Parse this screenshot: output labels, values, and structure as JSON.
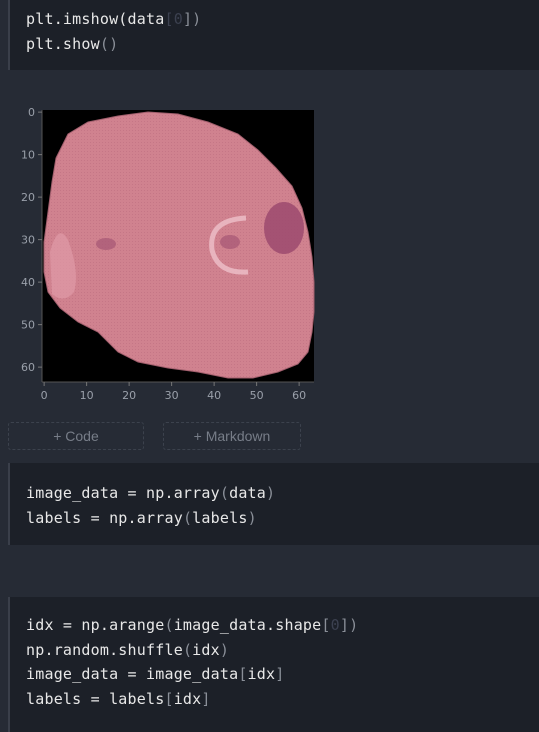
{
  "cells": {
    "c1": {
      "line1": {
        "a": "plt.imshow(data",
        "open": "[",
        "idx": "0",
        "close": "])"
      },
      "line2": {
        "a": "plt.show",
        "parens": "()"
      }
    },
    "c2": {
      "line1": {
        "a": "image_data = np.array",
        "o": "(",
        "arg": "data",
        "c": ")"
      },
      "line2": {
        "a": "labels = np.array",
        "o": "(",
        "arg": "labels",
        "c": ")"
      }
    },
    "c3": {
      "line1": {
        "a": "idx = np.arange",
        "o": "(",
        "arg": "image_data.shape",
        "ob": "[",
        "idx": "0",
        "cb": "]",
        "c": ")"
      },
      "line2": {
        "a": "np.random.shuffle",
        "o": "(",
        "arg": "idx",
        "c": ")"
      },
      "line3": {
        "a": "image_data = image_data",
        "ob": "[",
        "arg": "idx",
        "cb": "]"
      },
      "line4": {
        "a": "labels = labels",
        "ob": "[",
        "arg": "idx",
        "cb": "]"
      }
    }
  },
  "add_buttons": {
    "code": "+ Code",
    "markdown": "+ Markdown"
  },
  "plot": {
    "y_ticks": [
      "0",
      "10",
      "20",
      "30",
      "40",
      "50",
      "60"
    ],
    "x_ticks": [
      "0",
      "10",
      "20",
      "30",
      "40",
      "50",
      "60"
    ],
    "colors": {
      "background": "#000000",
      "tissue": "#d0828f",
      "stain": "#9c4a6e"
    }
  }
}
